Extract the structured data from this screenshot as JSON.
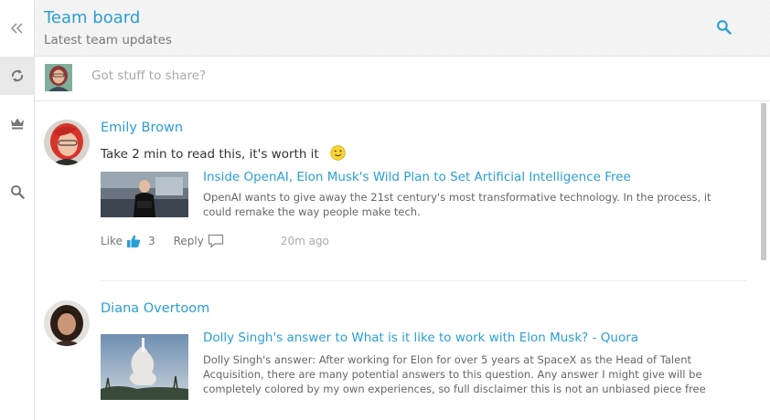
{
  "header": {
    "title": "Team board",
    "subtitle": "Latest team updates",
    "search_icon": "search-icon"
  },
  "sidebar": {
    "items": [
      {
        "icon": "collapse-icon",
        "active": false
      },
      {
        "icon": "refresh-icon",
        "active": true
      },
      {
        "icon": "crown-icon",
        "active": false
      },
      {
        "icon": "search-icon",
        "active": false
      }
    ]
  },
  "compose": {
    "placeholder": "Got stuff to share?"
  },
  "posts": [
    {
      "author": "Emily Brown",
      "text": "Take 2 min to read this, it's worth it",
      "emoji": "wink-icon",
      "link_title": "Inside OpenAI, Elon Musk's Wild Plan to Set Artificial Intelligence Free",
      "link_desc": "OpenAI wants to give away the 21st century's most transformative technology. In the process, it could remake the way people make tech.",
      "like_label": "Like",
      "like_count": "3",
      "reply_label": "Reply",
      "time": "20m ago"
    },
    {
      "author": "Diana Overtoom",
      "link_title": "Dolly Singh's answer to What is it like to work with Elon Musk? - Quora",
      "link_desc": "Dolly Singh's answer: After working for Elon for over 5 years at SpaceX as the Head of Talent Acquisition, there are many potential answers to this question. Any answer I might give will be completely colored by my own experiences, so full disclaimer this is not an unbiased piece free"
    }
  ],
  "colors": {
    "accent": "#2a9fd6",
    "sidebar_active": "#e9e9e9",
    "header_bg": "#f5f5f5"
  }
}
